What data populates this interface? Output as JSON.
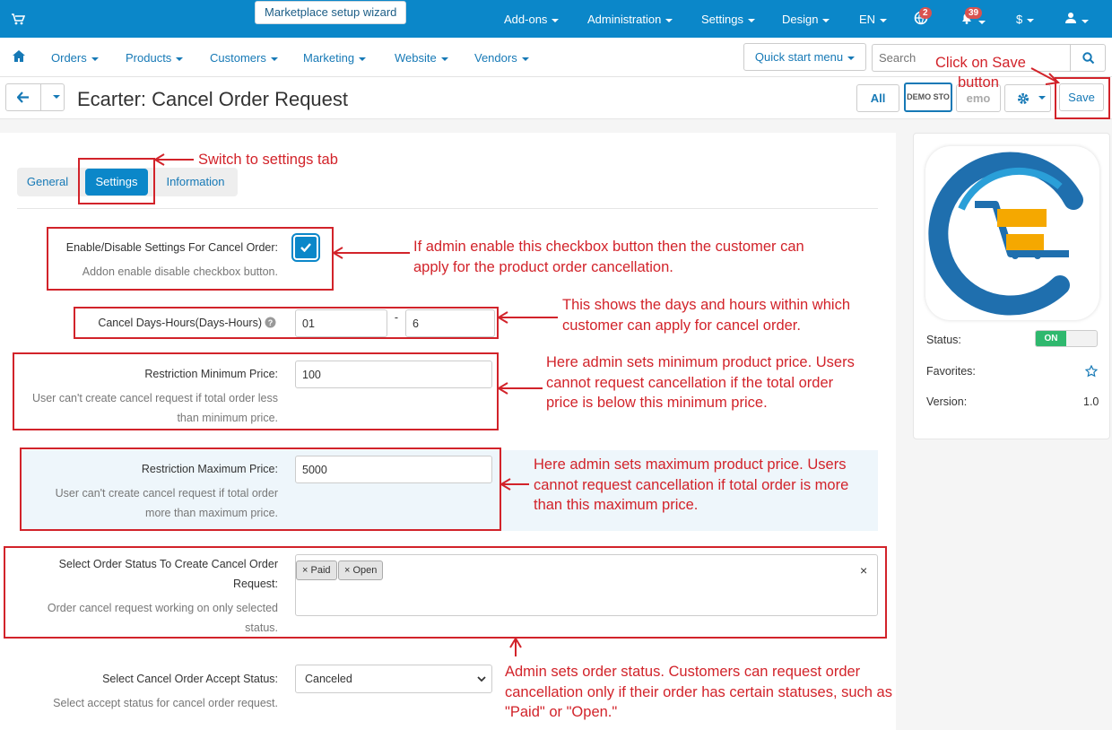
{
  "topbar": {
    "wizard": "Marketplace setup wizard",
    "addons": "Add-ons",
    "administration": "Administration",
    "settings": "Settings",
    "design": "Design",
    "language": "EN",
    "notif_count": "2",
    "bell_count": "39",
    "currency": "$"
  },
  "nav": {
    "orders": "Orders",
    "products": "Products",
    "customers": "Customers",
    "marketing": "Marketing",
    "website": "Website",
    "vendors": "Vendors",
    "quick_start": "Quick start menu",
    "search_placeholder": "Search"
  },
  "titlebar": {
    "title": "Ecarter: Cancel Order Request",
    "all": "All",
    "demo1": "DEMO STO",
    "demo2": "emo Sto",
    "save": "Save"
  },
  "tabs": [
    "General",
    "Settings",
    "Information"
  ],
  "form": {
    "enable_label": "Enable/Disable Settings For Cancel Order:",
    "enable_help": "Addon enable disable checkbox button.",
    "enable_checked": true,
    "days_label": "Cancel Days-Hours(Days-Hours)",
    "days_value": "01",
    "dash": "-",
    "hours_value": "6",
    "min_label": "Restriction Minimum Price:",
    "min_help_1": "User can't create cancel request if total order less",
    "min_help_2": "than minimum price.",
    "min_value": "100",
    "max_label": "Restriction Maximum Price:",
    "max_help_1": "User can't create cancel request if total order",
    "max_help_2": "more than maximum price.",
    "max_value": "5000",
    "status_label_1": "Select Order Status To Create Cancel Order",
    "status_label_2": "Request:",
    "status_help_1": "Order cancel request working on only selected",
    "status_help_2": "status.",
    "status_tags": [
      "Paid",
      "Open"
    ],
    "accept_label": "Select Cancel Order Accept Status:",
    "accept_help": "Select accept status for cancel order request.",
    "accept_value": "Canceled"
  },
  "side": {
    "status_label": "Status:",
    "status_value": "ON",
    "favorites_label": "Favorites:",
    "version_label": "Version:",
    "version_value": "1.0"
  },
  "annotations": {
    "save_1": "Click on Save",
    "save_2": "button",
    "settings_tab": "Switch to settings tab",
    "checkbox_1": "If admin enable this checkbox button then the customer can",
    "checkbox_2": "apply for the product order cancellation.",
    "days_1": "This shows the days and hours within which",
    "days_2": "customer can apply for cancel order.",
    "min_1": "Here admin sets minimum product price. Users",
    "min_2": "cannot request cancellation if the total order",
    "min_3": "price is below this minimum price.",
    "max_1": "Here admin sets maximum product price. Users",
    "max_2": "cannot request cancellation if total order is more",
    "max_3": "than this maximum price.",
    "status_1": "Admin sets order status. Customers can request order",
    "status_2": "cancellation only if their order has certain statuses, such as",
    "status_3": "\"Paid\" or \"Open.\""
  },
  "colors": {
    "brand_blue": "#0b87c9",
    "annotation_red": "#d2232a",
    "toggle_on": "#2fb86e"
  }
}
